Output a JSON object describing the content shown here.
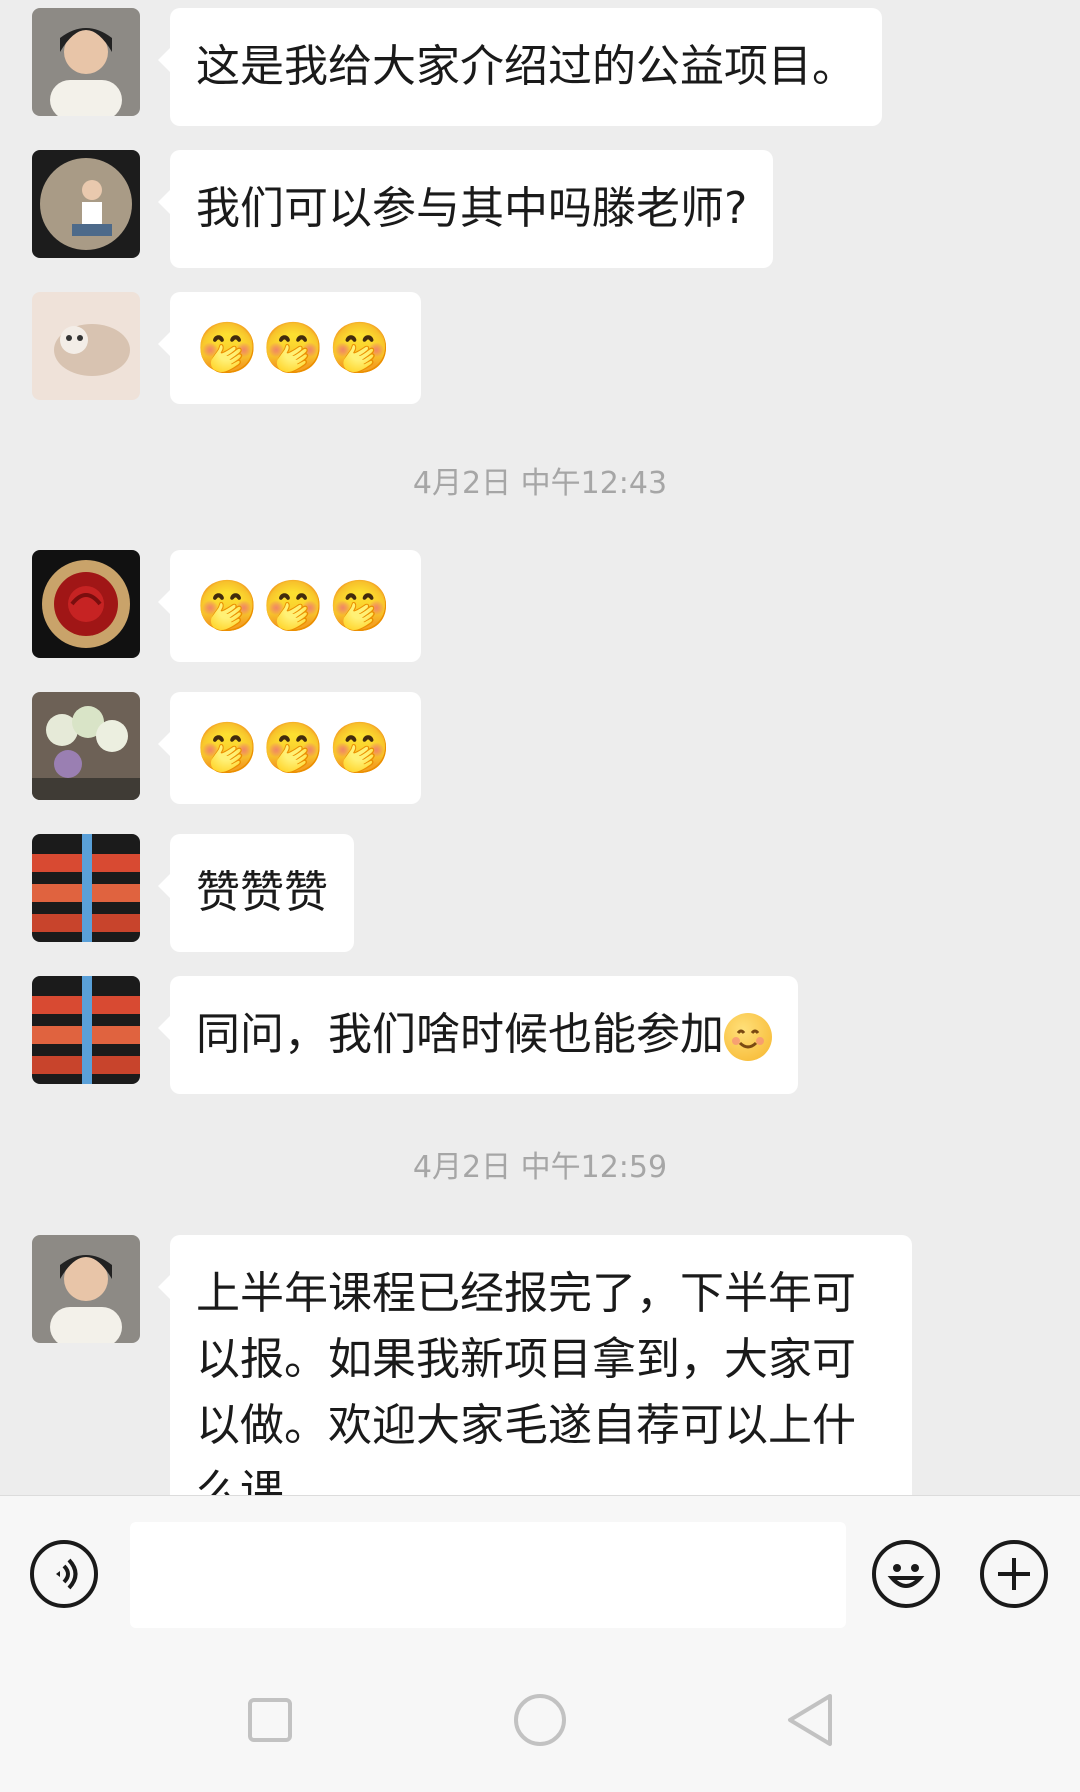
{
  "messages": [
    {
      "type": "text",
      "text": "这是我给大家介绍过的公益项目。"
    },
    {
      "type": "text",
      "text": "我们可以参与其中吗滕老师?"
    },
    {
      "type": "emoji",
      "text": "🤭🤭🤭"
    },
    {
      "type": "time",
      "text": "4月2日 中午12:43"
    },
    {
      "type": "emoji",
      "text": "🤭🤭🤭"
    },
    {
      "type": "emoji",
      "text": "🤭🤭🤭"
    },
    {
      "type": "text",
      "text": "赞赞赞"
    },
    {
      "type": "text",
      "text": "同问，我们啥时候也能参加",
      "emoji_after": "smile-face"
    },
    {
      "type": "time",
      "text": "4月2日 中午12:59"
    },
    {
      "type": "text",
      "text": "上半年课程已经报完了，下半年可以报。如果我新项目拿到，大家可以做。欢迎大家毛遂自荐可以上什么课"
    }
  ],
  "input": {
    "placeholder": ""
  },
  "icons": {
    "voice": "voice-icon",
    "emoji": "emoji-icon",
    "plus": "plus-icon",
    "nav_recent": "square-nav-icon",
    "nav_home": "circle-nav-icon",
    "nav_back": "triangle-back-icon"
  },
  "colors": {
    "background": "#ededed",
    "bubble": "#ffffff",
    "timestamp": "#a6a6a6"
  }
}
